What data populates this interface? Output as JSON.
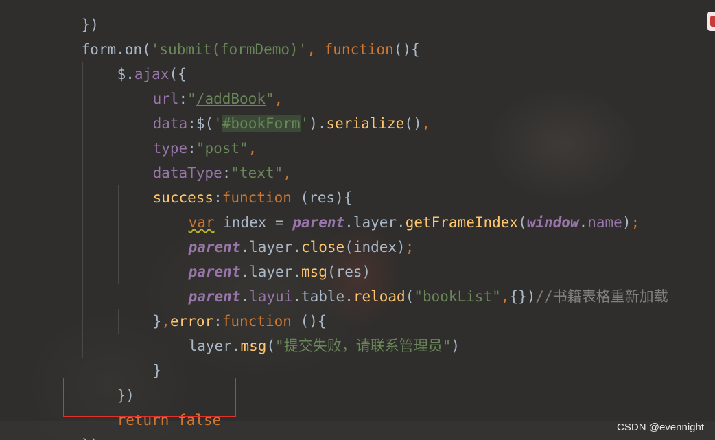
{
  "code_lines": [
    {
      "id": "line-0",
      "text": "})"
    },
    {
      "id": "line-1",
      "text": "form.on('submit(formDemo)', function(){"
    },
    {
      "id": "line-2",
      "text": "$.ajax({"
    },
    {
      "id": "line-3",
      "text": "url:\"/addBook\","
    },
    {
      "id": "line-4",
      "text": "data:$('#bookForm').serialize(),"
    },
    {
      "id": "line-5",
      "text": "type:\"post\","
    },
    {
      "id": "line-6",
      "text": "dataType:\"text\","
    },
    {
      "id": "line-7",
      "text": "success:function (res){"
    },
    {
      "id": "line-8",
      "text": "var index = parent.layer.getFrameIndex(window.name);"
    },
    {
      "id": "line-9",
      "text": "parent.layer.close(index);"
    },
    {
      "id": "line-10",
      "text": "parent.layer.msg(res)"
    },
    {
      "id": "line-11",
      "text": "parent.layui.table.reload(\"bookList\",{})//书籍表格重新加载"
    },
    {
      "id": "line-12",
      "text": "},error:function (){"
    },
    {
      "id": "line-13",
      "text": "layer.msg(\"提交失败，请联系管理员\")"
    },
    {
      "id": "line-14",
      "text": "}"
    },
    {
      "id": "line-15",
      "text": "})"
    },
    {
      "id": "line-16",
      "text": "return false"
    },
    {
      "id": "line-17",
      "text": "})"
    }
  ],
  "tokens": {
    "l0": [
      "})"
    ],
    "l1": [
      "form",
      ".",
      "on",
      "(",
      "'submit(formDemo)'",
      ", ",
      "function",
      "(){"
    ],
    "l2": [
      "$",
      ".",
      "ajax",
      "({"
    ],
    "l3": [
      "url",
      ":",
      "\"",
      "/addBook",
      "\"",
      ","
    ],
    "l4": [
      "data",
      ":",
      "$(",
      "'",
      "#bookForm",
      "'",
      ").",
      "serialize",
      "()",
      ","
    ],
    "l5": [
      "type",
      ":",
      "\"post\"",
      ","
    ],
    "l6": [
      "dataType",
      ":",
      "\"text\"",
      ","
    ],
    "l7": [
      "success",
      ":",
      "function",
      " (res){"
    ],
    "l8": [
      "var",
      " index = ",
      "parent",
      ".",
      "layer",
      ".",
      "getFrameIndex",
      "(",
      "window",
      ".",
      "name",
      ")",
      ";"
    ],
    "l9": [
      "parent",
      ".",
      "layer",
      ".",
      "close",
      "(index)",
      ";"
    ],
    "l10": [
      "parent",
      ".",
      "layer",
      ".",
      "msg",
      "(res)"
    ],
    "l11": [
      "parent",
      ".",
      "layui",
      ".",
      "table",
      ".",
      "reload",
      "(",
      "\"bookList\"",
      ",",
      "{})",
      "//书籍表格重新加载"
    ],
    "l12": [
      "}",
      ",",
      "error",
      ":",
      "function",
      " (){"
    ],
    "l13": [
      "layer",
      ".",
      "msg",
      "(",
      "\"提交失败，请联系管理员\"",
      ")"
    ],
    "l14": [
      "}"
    ],
    "l15": [
      "})"
    ],
    "l16": [
      "return",
      " ",
      "false"
    ],
    "l17": [
      "})"
    ]
  },
  "highlight_box_color": "#e0312b",
  "colors": {
    "background": "#2f2e2c",
    "default_text": "#a9b7c6",
    "keyword": "#cc7832",
    "string": "#6a8759",
    "function": "#ffc66d",
    "property": "#9876aa",
    "comment": "#808080"
  },
  "watermark": "CSDN @evennight"
}
